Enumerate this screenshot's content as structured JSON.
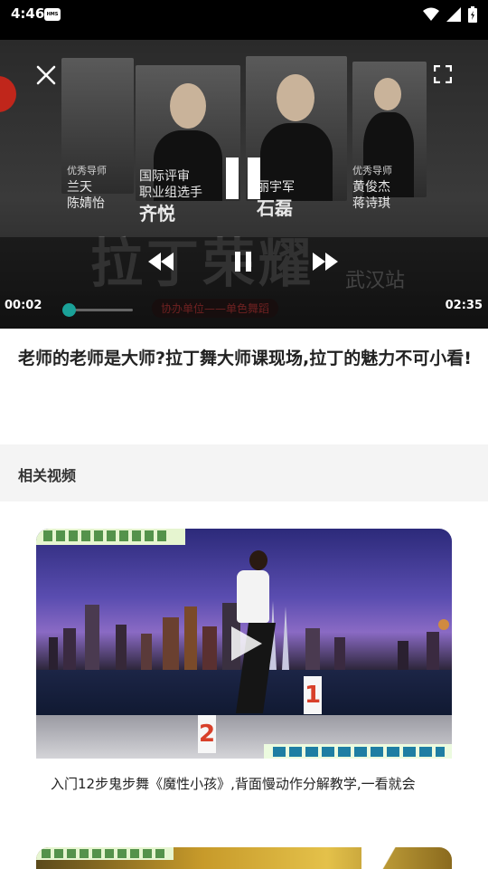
{
  "status_bar": {
    "time": "4:46",
    "badge": "HMS"
  },
  "player": {
    "current_time": "00:02",
    "total_time": "02:35",
    "progress": 0.013,
    "accent_color": "#1aa198",
    "poster": {
      "labels_left": [
        "优秀导师",
        "兰天",
        "陈婧怡"
      ],
      "labels_mid": [
        "国际评审",
        "职业组选手",
        "齐悦"
      ],
      "labels_right_mid": [
        "丽宇军",
        "石磊"
      ],
      "labels_right": [
        "优秀导师",
        "黄俊杰",
        "蒋诗琪"
      ],
      "title": "拉丁荣耀",
      "city": "武汉站",
      "subtitle": "协办单位——单色舞蹈"
    }
  },
  "video": {
    "title": "老师的老师是大师?拉丁舞大师课现场,拉丁的魅力不可小看!"
  },
  "related": {
    "header": "相关视频",
    "items": [
      {
        "title": "入门12步鬼步舞《魔性小孩》,背面慢动作分解教学,一看就会",
        "thumb_numbers": [
          "1",
          "2"
        ]
      },
      {
        "title": ""
      }
    ]
  },
  "icons": {
    "close": "close-icon",
    "fullscreen": "fullscreen-icon",
    "pause": "pause-icon",
    "rewind": "rewind-icon",
    "forward": "fast-forward-icon",
    "play": "play-icon",
    "wifi": "wifi-icon",
    "signal": "signal-icon",
    "battery": "battery-icon"
  }
}
